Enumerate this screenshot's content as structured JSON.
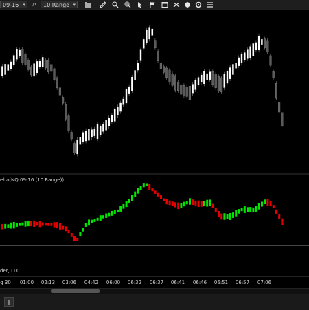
{
  "toolbar": {
    "instrument": "09-16",
    "bar_type": "10 Range",
    "icons": [
      "search-icon",
      "bar-chart-icon",
      "pencil-icon",
      "zoom-icon",
      "cursor-icon",
      "flag-icon",
      "shuffle-icon",
      "settings-icon",
      "list-icon"
    ]
  },
  "panels": {
    "delta_label": "elta(NQ 09-16 (10 Range))",
    "copyright": "der, LLC"
  },
  "xaxis": {
    "labels": [
      "g 30",
      "01:00",
      "02:13",
      "03:06",
      "04:42",
      "06:00",
      "06:32",
      "06:37",
      "06:41",
      "06:46",
      "06:51",
      "06:57",
      "07:06"
    ]
  },
  "tabs": {
    "add_label": "+"
  },
  "colors": {
    "background": "#000000",
    "up_candle": "#ffffff",
    "down_candle": "#5a5a5a",
    "delta_up": "#00e600",
    "delta_down": "#e60000",
    "separator": "#8a8a8a"
  }
}
